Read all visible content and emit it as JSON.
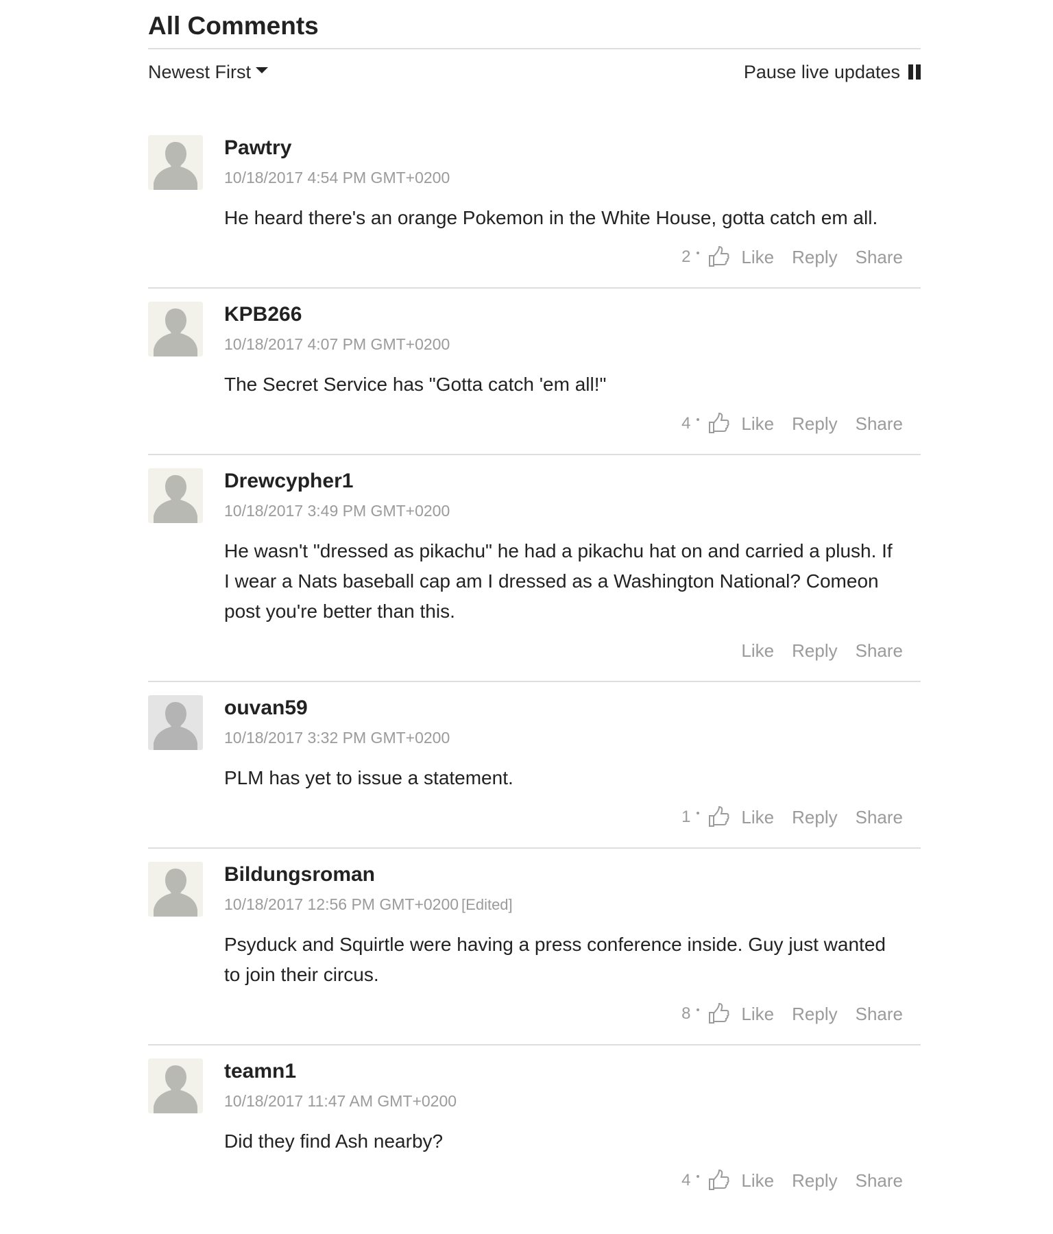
{
  "heading": "All Comments",
  "controls": {
    "sort_label": "Newest First",
    "pause_label": "Pause live updates"
  },
  "actions": {
    "like": "Like",
    "reply": "Reply",
    "share": "Share"
  },
  "comments": [
    {
      "author": "Pawtry",
      "time": "10/18/2017 4:54 PM GMT+0200",
      "edited": "",
      "text": "He heard there's an orange Pokemon in the White House, gotta catch em all.",
      "likes": "2"
    },
    {
      "author": "KPB266",
      "time": "10/18/2017 4:07 PM GMT+0200",
      "edited": "",
      "text": "The Secret Service has \"Gotta catch 'em all!\"",
      "likes": "4"
    },
    {
      "author": "Drewcypher1",
      "time": "10/18/2017 3:49 PM GMT+0200",
      "edited": "",
      "text": "He wasn't \"dressed as pikachu\" he had a pikachu hat on and carried a plush. If I wear a Nats baseball cap am I dressed as a Washington National? Comeon post you're better than this.",
      "likes": ""
    },
    {
      "author": "ouvan59",
      "time": "10/18/2017 3:32 PM GMT+0200",
      "edited": "",
      "text": "PLM has yet to issue a statement.",
      "likes": "1"
    },
    {
      "author": "Bildungsroman",
      "time": "10/18/2017 12:56 PM GMT+0200",
      "edited": "[Edited]",
      "text": "Psyduck and Squirtle were having a press conference inside. Guy just wanted to join their circus.",
      "likes": "8"
    },
    {
      "author": "teamn1",
      "time": "10/18/2017 11:47 AM GMT+0200",
      "edited": "",
      "text": "Did they find Ash nearby?",
      "likes": "4"
    }
  ]
}
